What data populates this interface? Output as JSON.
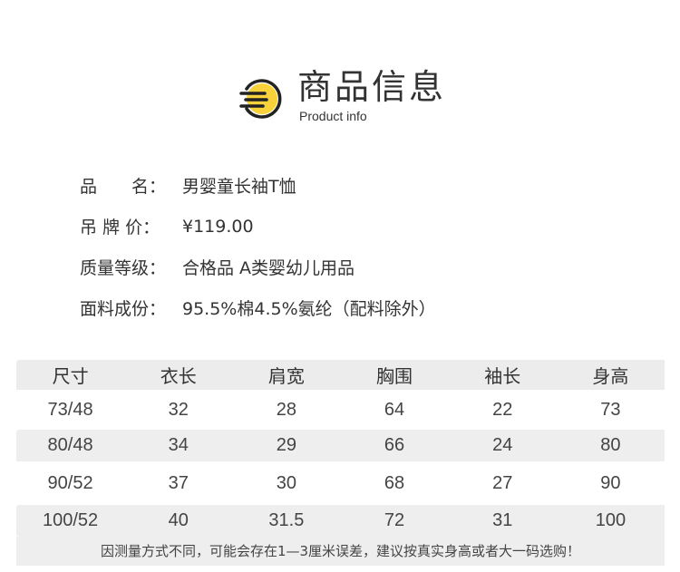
{
  "header": {
    "title": "商品信息",
    "subtitle": "Product info"
  },
  "info": [
    {
      "label": "品　　名：",
      "value": "男婴童长袖T恤"
    },
    {
      "label": "吊 牌 价：",
      "value": "¥119.00"
    },
    {
      "label": "质量等级：",
      "value": "合格品 A类婴幼儿用品"
    },
    {
      "label": "面料成份：",
      "value": "95.5%棉4.5%氨纶（配料除外）"
    }
  ],
  "table": {
    "headers": [
      "尺寸",
      "衣长",
      "肩宽",
      "胸围",
      "袖长",
      "身高"
    ],
    "rows": [
      [
        "73/48",
        "32",
        "28",
        "64",
        "22",
        "73"
      ],
      [
        "80/48",
        "34",
        "29",
        "66",
        "24",
        "80"
      ],
      [
        "90/52",
        "37",
        "30",
        "68",
        "27",
        "90"
      ],
      [
        "100/52",
        "40",
        "31.5",
        "72",
        "31",
        "100"
      ]
    ],
    "note": "因测量方式不同，可能会存在1—3厘米误差，建议按真实身高或者大一码选购！"
  },
  "colors": {
    "accent": "#f7d23a",
    "text": "#333333",
    "row_shade": "#eeeeee"
  },
  "icons": {
    "logo": "document-lines-icon"
  }
}
